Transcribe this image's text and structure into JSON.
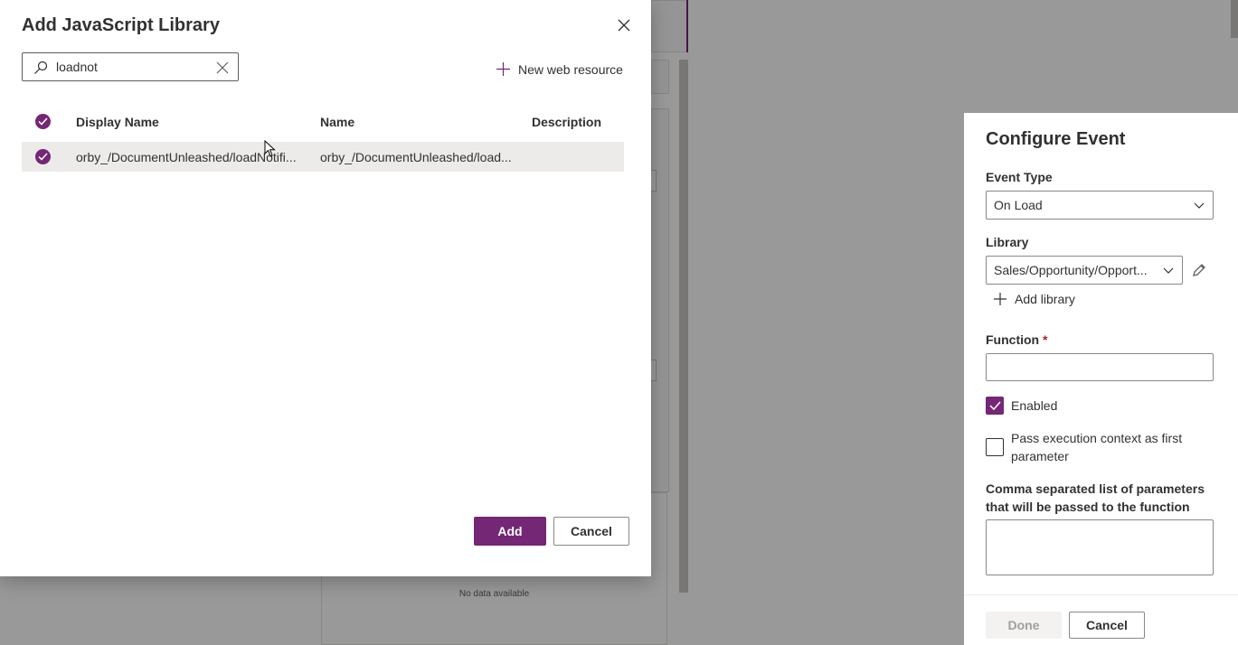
{
  "dialog": {
    "title": "Add JavaScript Library",
    "search_value": "loadnot",
    "new_resource_label": "New web resource",
    "columns": [
      "Display Name",
      "Name",
      "Description"
    ],
    "rows": [
      {
        "display_name": "orby_/DocumentUnleashed/loadNotifi...",
        "name": "orby_/DocumentUnleashed/load...",
        "description": "",
        "selected": true
      }
    ],
    "add_label": "Add",
    "cancel_label": "Cancel"
  },
  "config_panel": {
    "title": "Configure Event",
    "event_type_label": "Event Type",
    "event_type_value": "On Load",
    "library_label": "Library",
    "library_value": "Sales/Opportunity/Opport...",
    "add_library_label": "Add library",
    "function_label": "Function",
    "function_required": "*",
    "function_value": "",
    "enabled_label": "Enabled",
    "enabled_checked": true,
    "pass_context_label_line1": "Pass execution context as first",
    "pass_context_label_line2": "parameter",
    "pass_context_checked": false,
    "params_label_line1": "Comma separated list of parameters",
    "params_label_line2": "that will be passed to the function",
    "params_value": "",
    "done_label": "Done",
    "cancel_label": "Cancel"
  },
  "background": {
    "no_data_text": "No data available"
  },
  "colors": {
    "accent": "#742774",
    "overlay": "rgba(0,0,0,0.4)",
    "selected_row": "#edebe9"
  }
}
